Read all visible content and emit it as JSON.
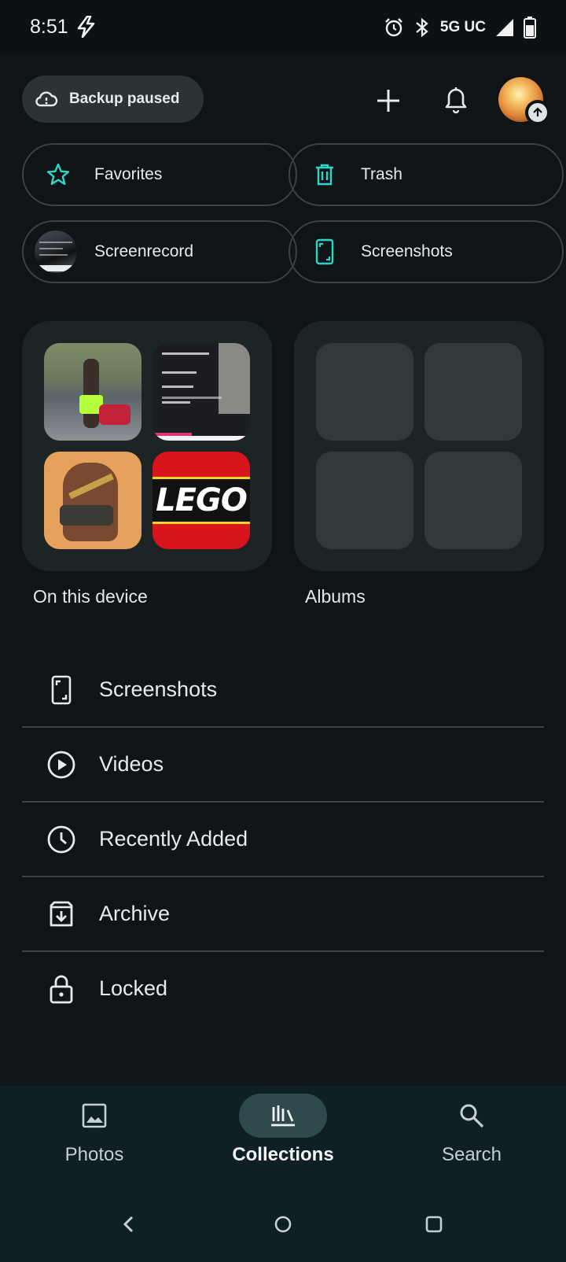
{
  "status_bar": {
    "time": "8:51",
    "network": "5G UC"
  },
  "header": {
    "backup_label": "Backup paused"
  },
  "quick_links": [
    {
      "label": "Favorites"
    },
    {
      "label": "Trash"
    },
    {
      "label": "Screenrecord"
    },
    {
      "label": "Screenshots"
    }
  ],
  "cards": {
    "device_label": "On this device",
    "albums_label": "Albums"
  },
  "device_tiles": {
    "lego_text": "LEGO"
  },
  "list": [
    {
      "label": "Screenshots",
      "icon": "phone-screenshot-icon"
    },
    {
      "label": "Videos",
      "icon": "play-circle-icon"
    },
    {
      "label": "Recently Added",
      "icon": "clock-icon"
    },
    {
      "label": "Archive",
      "icon": "archive-icon"
    },
    {
      "label": "Locked",
      "icon": "lock-icon"
    }
  ],
  "bottom_nav": [
    {
      "label": "Photos",
      "icon": "photo-icon",
      "active": false
    },
    {
      "label": "Collections",
      "icon": "collections-icon",
      "active": true
    },
    {
      "label": "Search",
      "icon": "search-icon",
      "active": false
    }
  ],
  "colors": {
    "background": "#0f1516",
    "accent_teal": "#2fd6c6",
    "chip_bg": "#2c3335",
    "nav_bg": "#0f2024",
    "nav_active_pill": "#2f4a4c"
  }
}
